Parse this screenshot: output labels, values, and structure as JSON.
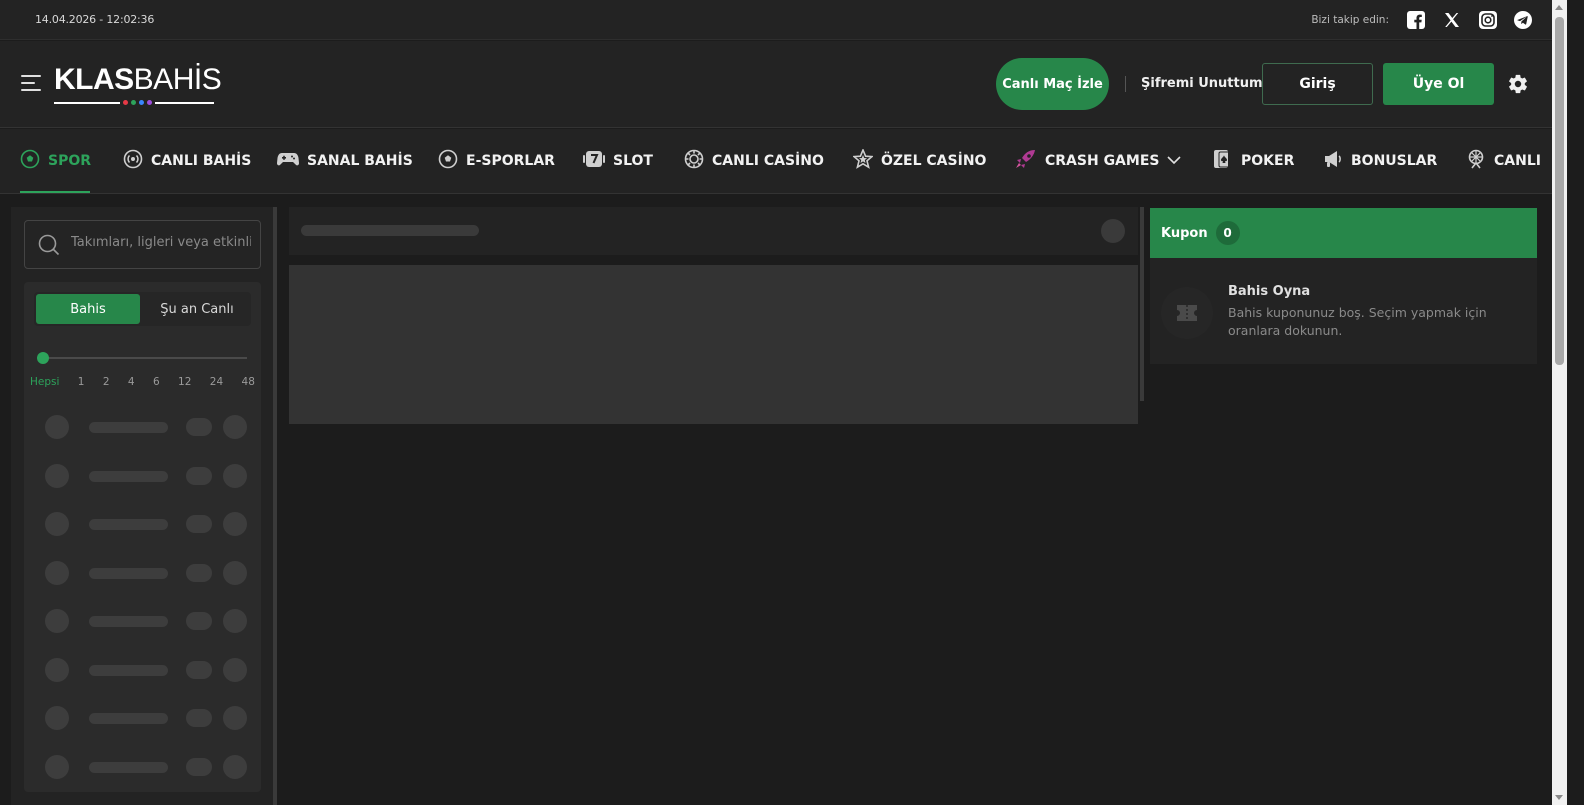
{
  "topbar": {
    "datetime": "14.04.2026 - 12:02:36",
    "follow_label": "Bizi takip edin:",
    "socials": [
      "facebook-icon",
      "x-icon",
      "instagram-icon",
      "telegram-icon"
    ]
  },
  "header": {
    "logo_bold": "KLAS",
    "logo_thin": "BAHİS",
    "logo_dot_colors": [
      "#e63946",
      "#2da35b",
      "#3a86ff",
      "#9d4edd"
    ],
    "live_button": "Canlı Maç İzle",
    "forgot_password": "Şifremi Unuttum",
    "login_button": "Giriş",
    "register_button": "Üye Ol"
  },
  "nav": {
    "items": [
      {
        "label": "SPOR",
        "icon": "soccer-ball-icon",
        "active": true
      },
      {
        "label": "CANLI BAHİS",
        "icon": "live-broadcast-icon"
      },
      {
        "label": "SANAL BAHİS",
        "icon": "gamepad-icon"
      },
      {
        "label": "E-SPORLAR",
        "icon": "esports-ball-icon"
      },
      {
        "label": "SLOT",
        "icon": "slot-seven-icon"
      },
      {
        "label": "CANLI CASİNO",
        "icon": "casino-chip-icon"
      },
      {
        "label": "ÖZEL CASİNO",
        "icon": "star-icon"
      },
      {
        "label": "CRASH GAMES",
        "icon": "rocket-icon"
      },
      {
        "label": "POKER",
        "icon": "playing-card-icon"
      },
      {
        "label": "BONUSLAR",
        "icon": "megaphone-icon"
      },
      {
        "label": "CANLI",
        "icon": "ferris-wheel-icon"
      }
    ]
  },
  "sidebar": {
    "search_placeholder": "Takımları, ligleri veya etkinlikleri ara",
    "tabs": [
      "Bahis",
      "Şu an Canlı"
    ],
    "active_tab": "Bahis",
    "time_filters": [
      "Hepsi",
      "1",
      "2",
      "4",
      "6",
      "12",
      "24",
      "48"
    ],
    "selected_time_filter": "Hepsi"
  },
  "coupon": {
    "title": "Kupon",
    "count": "0",
    "empty_title": "Bahis Oyna",
    "empty_text": "Bahis kuponunuz boş. Seçim yapmak için oranlara dokunun."
  },
  "colors": {
    "accent": "#27874a",
    "accent_text": "#2da35b",
    "background": "#1c1c1c",
    "panel": "#232323"
  }
}
